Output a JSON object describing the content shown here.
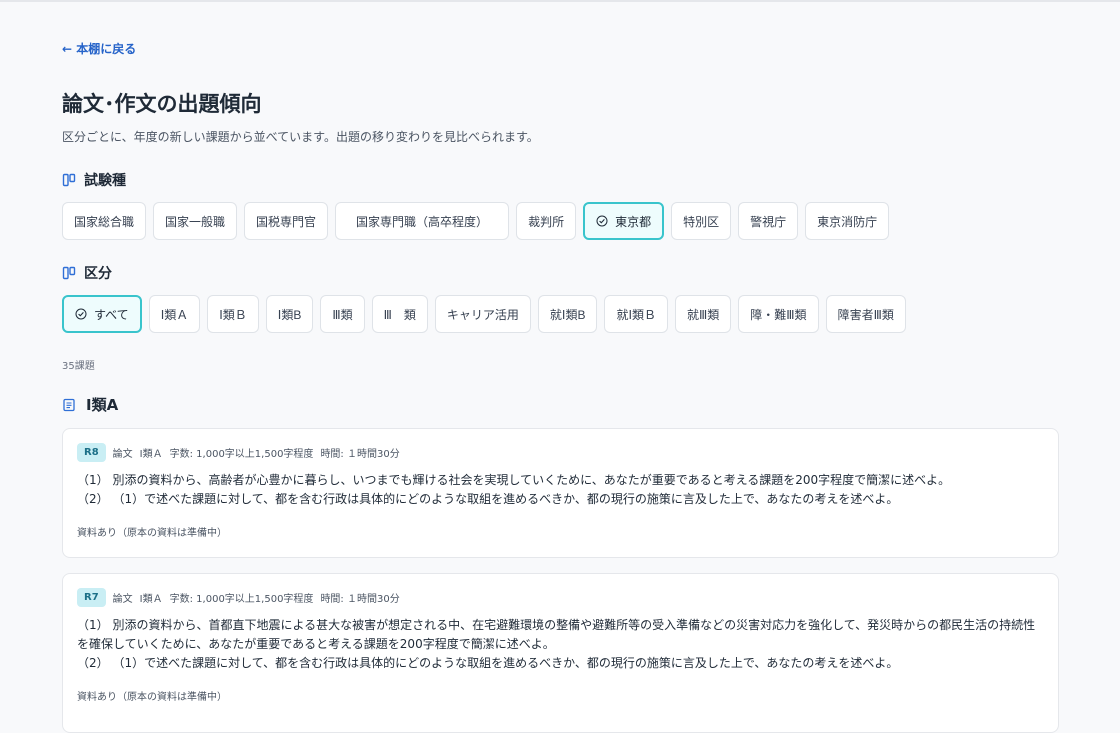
{
  "nav": {
    "back_label": "← 本棚に戻る"
  },
  "page": {
    "title": "論文･作文の出題傾向",
    "description": "区分ごとに、年度の新しい課題から並べています。出題の移り変わりを見比べられます。"
  },
  "exam_types": {
    "heading": "試験種",
    "items": [
      {
        "label": "国家総合職",
        "active": false
      },
      {
        "label": "国家一般職",
        "active": false
      },
      {
        "label": "国税専門官",
        "active": false
      },
      {
        "label": "国家専門職（高卒程度）",
        "active": false
      },
      {
        "label": "裁判所",
        "active": false
      },
      {
        "label": "東京都",
        "active": true
      },
      {
        "label": "特別区",
        "active": false
      },
      {
        "label": "警視庁",
        "active": false
      },
      {
        "label": "東京消防庁",
        "active": false
      }
    ]
  },
  "categories": {
    "heading": "区分",
    "items": [
      {
        "label": "すべて",
        "active": true
      },
      {
        "label": "Ⅰ類Ａ",
        "active": false
      },
      {
        "label": "Ⅰ類Ｂ",
        "active": false
      },
      {
        "label": "Ⅰ類B",
        "active": false
      },
      {
        "label": "Ⅲ類",
        "active": false
      },
      {
        "label": "Ⅲ　類",
        "active": false
      },
      {
        "label": "キャリア活用",
        "active": false
      },
      {
        "label": "就Ⅰ類B",
        "active": false
      },
      {
        "label": "就Ⅰ類Ｂ",
        "active": false
      },
      {
        "label": "就Ⅲ類",
        "active": false
      },
      {
        "label": "障・難Ⅲ類",
        "active": false
      },
      {
        "label": "障害者Ⅲ類",
        "active": false
      }
    ]
  },
  "count_label": "35課題",
  "group": {
    "title": "Ⅰ類A",
    "cards": [
      {
        "year": "R8",
        "type": "論文",
        "category": "Ⅰ類Ａ",
        "chars": "字数: 1,000字以上1,500字程度",
        "time": "時間: １時間30分",
        "questions": [
          "（1） 別添の資料から、高齢者が心豊かに暮らし、いつまでも輝ける社会を実現していくために、あなたが重要であると考える課題を200字程度で簡潔に述べよ。",
          "（2） （1）で述べた課題に対して、都を含む行政は具体的にどのような取組を進めるべきか、都の現行の施策に言及した上で、あなたの考えを述べよ。"
        ],
        "note": "資料あり（原本の資料は準備中）"
      },
      {
        "year": "R7",
        "type": "論文",
        "category": "Ⅰ類Ａ",
        "chars": "字数: 1,000字以上1,500字程度",
        "time": "時間: １時間30分",
        "questions": [
          "（1） 別添の資料から、首都直下地震による甚大な被害が想定される中、在宅避難環境の整備や避難所等の受入準備などの災害対応力を強化して、発災時からの都民生活の持続性を確保していくために、あなたが重要であると考える課題を200字程度で簡潔に述べよ。",
          "（2） （1）で述べた課題に対して、都を含む行政は具体的にどのような取組を進めるべきか、都の現行の施策に言及した上で、あなたの考えを述べよ。"
        ],
        "note": "資料あり（原本の資料は準備中）"
      }
    ]
  }
}
